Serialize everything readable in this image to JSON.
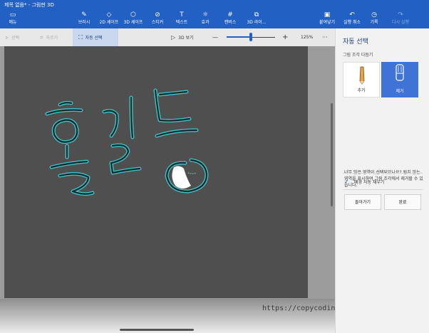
{
  "app": {
    "title": "제목 없음* - 그림판 3D"
  },
  "toolbar": {
    "menu": "메뉴",
    "brushes": "브러시",
    "shapes_2d": "2D 셰이프",
    "shapes_3d": "3D 셰이프",
    "stickers": "스티커",
    "text": "텍스트",
    "effects": "효과",
    "canvas": "캔버스",
    "library_3d": "3D 라이...",
    "paste": "붙여넣기",
    "undo": "실행 취소",
    "history": "기록",
    "redo": "다시 실행"
  },
  "subbar": {
    "select": "선택",
    "crop": "자르기",
    "magic_select": "자동 선택",
    "view_3d": "3D 보기",
    "zoom_out": "—",
    "zoom_in": "+",
    "zoom_level": "125%",
    "more": "···"
  },
  "panel": {
    "title": "자동 선택",
    "subtitle": "그림 조각 다듬기",
    "add_label": "추가",
    "remove_label": "제거",
    "help_text": "너무 많은 영역이 선택되었나요? 원치 않는 영역을 표시하여 그림 조각에서 제거할 수 있습니다.",
    "autofill_label": "배경 자동 채우기",
    "back_button": "돌아가기",
    "done_button": "완료"
  },
  "canvas": {
    "handwriting": "홍길동"
  },
  "watermark": "https://copycoding.tistory.com/",
  "colors": {
    "accent": "#2360c4",
    "selected_tool": "#3f73d6",
    "canvas": "#4f4f4f",
    "stroke": "#0f2a2c",
    "glow": "#3fd2d9"
  }
}
